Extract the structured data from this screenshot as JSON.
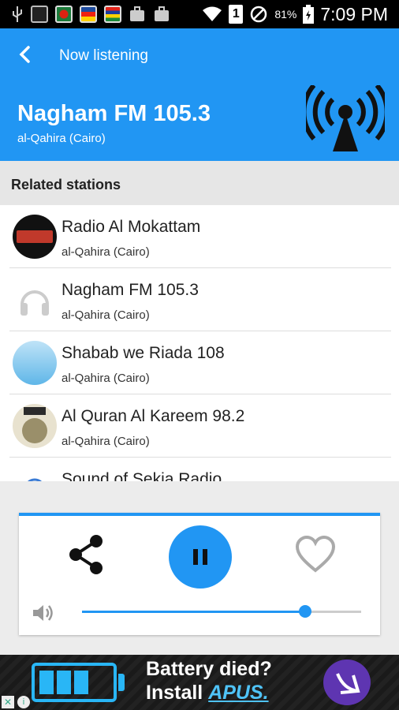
{
  "status_bar": {
    "battery": "81%",
    "time": "7:09 PM",
    "notification_badge": "1"
  },
  "header": {
    "nav_title": "Now listening",
    "station_name": "Nagham FM 105.3",
    "station_city": "al-Qahira (Cairo)",
    "background_color": "#2196f3"
  },
  "related": {
    "title": "Related stations",
    "stations": [
      {
        "name": "Radio Al Mokattam",
        "city": "al-Qahira (Cairo)",
        "logo": "mokattam-logo"
      },
      {
        "name": "Nagham FM 105.3",
        "city": "al-Qahira (Cairo)",
        "logo": "headphones-icon"
      },
      {
        "name": "Shabab we Riada 108",
        "city": "al-Qahira (Cairo)",
        "logo": "shabab-logo"
      },
      {
        "name": "Al Quran Al Kareem 98.2",
        "city": "al-Qahira (Cairo)",
        "logo": "quran-logo"
      },
      {
        "name": "Sound of Sekia Radio",
        "city": "",
        "logo": "sekia-logo"
      }
    ]
  },
  "player": {
    "accent_color": "#2196f3",
    "volume_level": 0.8,
    "state": "playing",
    "icons": [
      "share-icon",
      "pause-icon",
      "heart-icon",
      "volume-icon"
    ]
  },
  "ad": {
    "line1": "Battery died?",
    "line2_prefix": "Install ",
    "line2_brand": "APUS."
  }
}
